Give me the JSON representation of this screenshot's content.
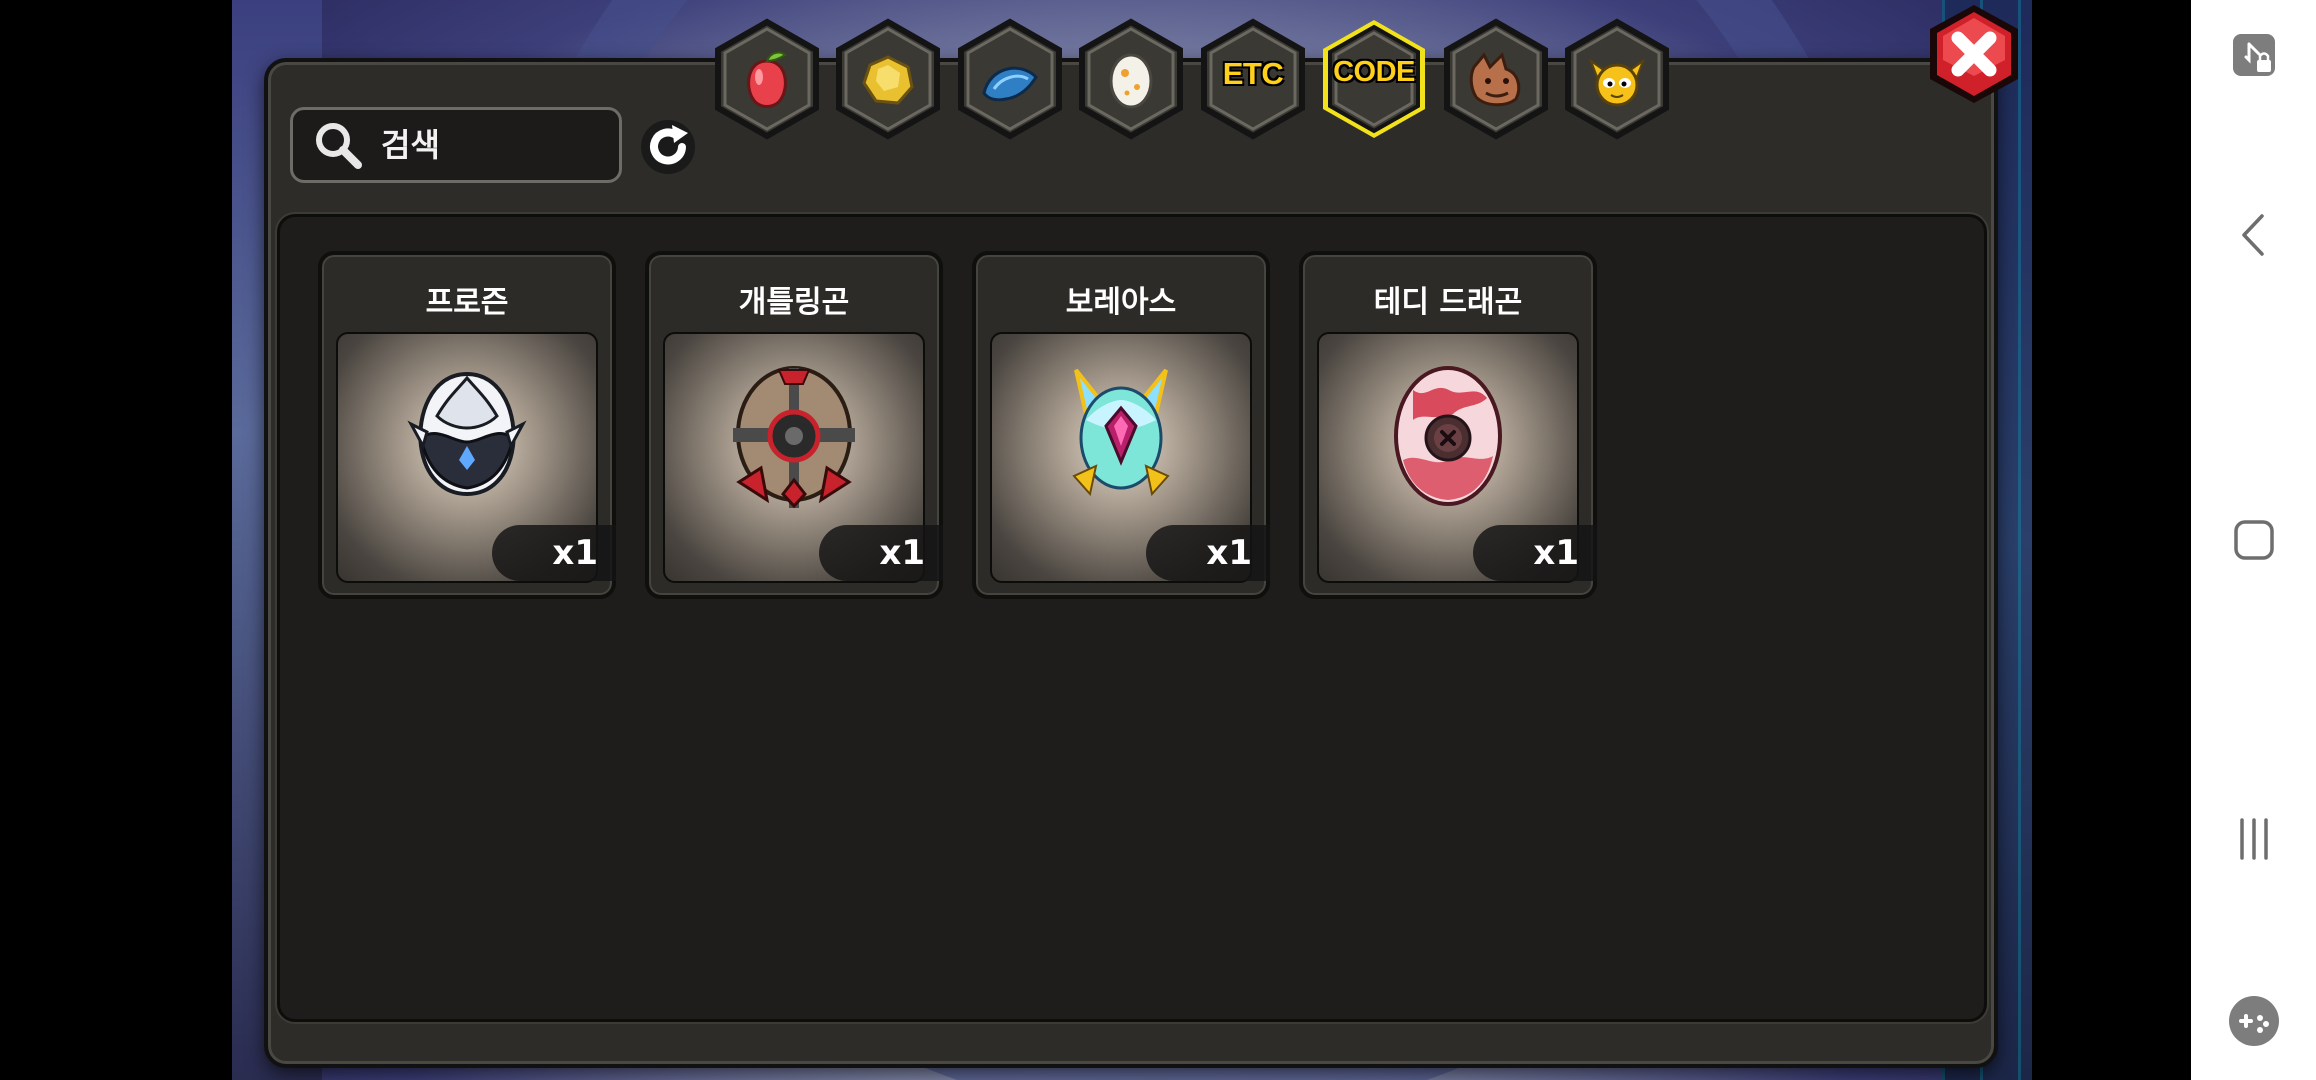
{
  "search": {
    "placeholder": "검색"
  },
  "tabs": [
    {
      "name": "fruit",
      "label": "",
      "icon": "red-fruit-icon",
      "selected": false
    },
    {
      "name": "gold",
      "label": "",
      "icon": "gold-nugget-icon",
      "selected": false
    },
    {
      "name": "scale",
      "label": "",
      "icon": "blue-dragon-scale-icon",
      "selected": false
    },
    {
      "name": "egg",
      "label": "",
      "icon": "spotted-egg-icon",
      "selected": false
    },
    {
      "name": "etc",
      "label": "ETC",
      "icon": "",
      "selected": false
    },
    {
      "name": "code",
      "label": "CODE",
      "icon": "",
      "selected": true
    },
    {
      "name": "dragon",
      "label": "",
      "icon": "dragon-head-icon",
      "selected": false
    },
    {
      "name": "mascot",
      "label": "",
      "icon": "winged-mascot-icon",
      "selected": false
    }
  ],
  "items": [
    {
      "name": "프로즌",
      "qty": "x1",
      "icon": "frozen-egg-icon"
    },
    {
      "name": "개틀링곤",
      "qty": "x1",
      "icon": "gatlinggon-egg-icon"
    },
    {
      "name": "보레아스",
      "qty": "x1",
      "icon": "boreas-egg-icon"
    },
    {
      "name": "테디 드래곤",
      "qty": "x1",
      "icon": "teddy-dragon-egg-icon"
    }
  ],
  "colors": {
    "tab_selected_border": "#f2e21b",
    "tab_label": "#ffcf1a",
    "close_button": "#d0202a",
    "panel": "#2d2c28"
  }
}
